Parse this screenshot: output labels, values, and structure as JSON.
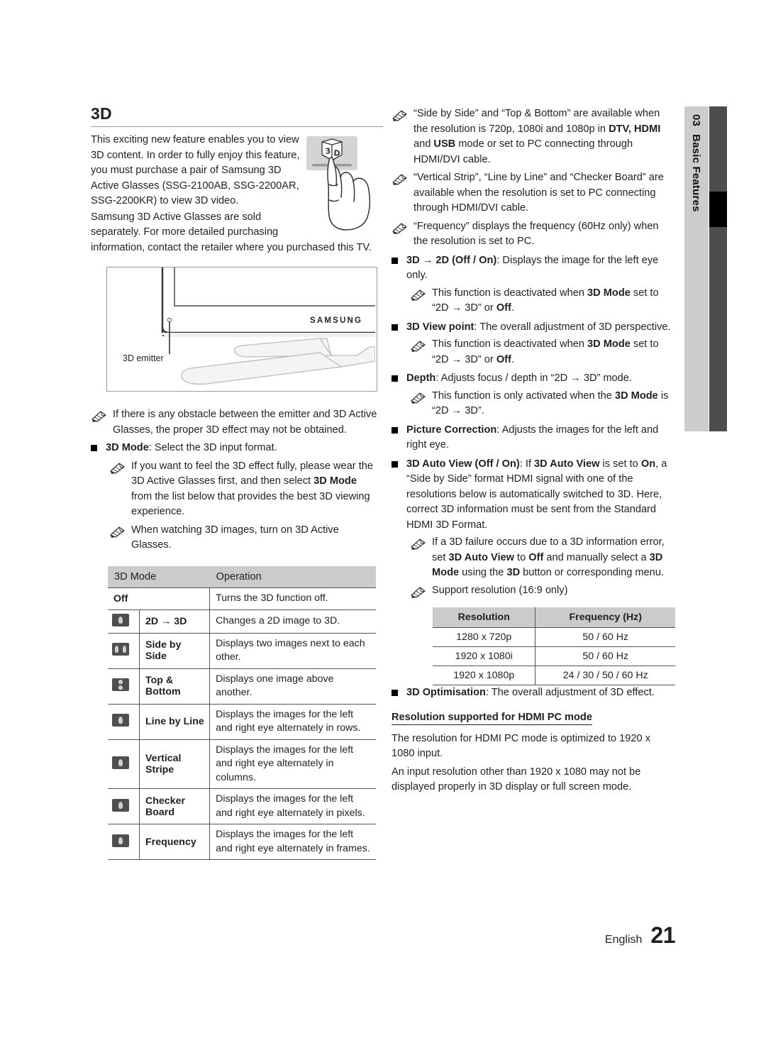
{
  "sidebar": {
    "chapter_number": "03",
    "chapter_title": "Basic Features"
  },
  "footer": {
    "language": "English",
    "page_number": "21"
  },
  "left": {
    "heading": "3D",
    "intro_p1": "This exciting new feature enables you to view 3D content. In order to fully enjoy this feature, you must purchase a pair of Samsung 3D Active Glasses (SSG-2100AB, SSG-2200AR, SSG-2200KR) to view 3D video.",
    "intro_p2": "Samsung 3D Active Glasses are sold separately. For more detailed purchasing",
    "intro_p3": "information, contact the retailer where you purchased this TV.",
    "figure": {
      "brand": "SAMSUNG",
      "callout": "3D emitter",
      "button_label": "3D"
    },
    "note_obstacle": "If there is any obstacle between the emitter and 3D Active Glasses, the proper 3D effect may not be obtained.",
    "bullet_3dmode_strong": "3D Mode",
    "bullet_3dmode_rest": ": Select the 3D input format.",
    "note_wear_a": "If you want to feel the 3D effect fully, please wear the 3D Active Glasses first, and then select ",
    "note_wear_b": "3D Mode",
    "note_wear_c": " from the list below that provides the best 3D viewing experience.",
    "note_turnon": "When watching 3D images, turn on 3D Active Glasses."
  },
  "mode_table": {
    "headers": [
      "3D Mode",
      "Operation"
    ],
    "rows": [
      {
        "icon": "none",
        "name": "Off",
        "operation": "Turns the 3D function off."
      },
      {
        "icon": "2d-to-3d-icon",
        "name": "2D → 3D",
        "operation": "Changes a 2D image to 3D."
      },
      {
        "icon": "side-by-side-icon",
        "name": "Side by Side",
        "operation": "Displays two images next to each other."
      },
      {
        "icon": "top-bottom-icon",
        "name": "Top & Bottom",
        "operation": "Displays one image above another."
      },
      {
        "icon": "line-by-line-icon",
        "name": "Line by Line",
        "operation": "Displays the images for the left and right eye alternately in rows."
      },
      {
        "icon": "vertical-stripe-icon",
        "name": "Vertical Stripe",
        "operation": "Displays the images for the left and right eye alternately in columns."
      },
      {
        "icon": "checker-board-icon",
        "name": "Checker Board",
        "operation": "Displays the images for the left and right eye alternately in pixels."
      },
      {
        "icon": "frequency-icon",
        "name": "Frequency",
        "operation": "Displays the images for the left and right eye alternately in frames."
      }
    ]
  },
  "right": {
    "note_sbs_a": "“Side by Side” and “Top & Bottom” are available when the resolution is 720p, 1080i and 1080p in ",
    "note_sbs_b": "DTV, HDMI",
    "note_sbs_c": " and ",
    "note_sbs_d": "USB",
    "note_sbs_e": " mode or set to PC connecting through HDMI/DVI cable.",
    "note_vstrip": "“Vertical Strip”, “Line by Line” and “Checker Board” are available when the resolution is set to PC connecting through HDMI/DVI cable.",
    "note_freq": "“Frequency” displays the frequency (60Hz only) when the resolution is set to PC.",
    "b1_strong": "3D → 2D (Off / On)",
    "b1_rest": ": Displays the image for the left eye only.",
    "b1_note_a": "This function is deactivated when ",
    "b1_note_b": "3D Mode",
    "b1_note_c": " set to “2D → 3D” or ",
    "b1_note_d": "Off",
    "b1_note_e": ".",
    "b2_strong": "3D View point",
    "b2_rest": ": The overall adjustment of 3D perspective.",
    "b2_note_a": "This function is deactivated when ",
    "b2_note_b": "3D Mode",
    "b2_note_c": " set to “2D → 3D” or ",
    "b2_note_d": "Off",
    "b2_note_e": ".",
    "b3_strong": "Depth",
    "b3_rest": ": Adjusts focus / depth in “2D → 3D” mode.",
    "b3_note_a": "This function is only activated when the ",
    "b3_note_b": "3D Mode",
    "b3_note_c": " is “2D → 3D”.",
    "b4_strong": "Picture Correction",
    "b4_rest": ": Adjusts the images for the left and right eye.",
    "b5_strong": "3D Auto View (Off / On)",
    "b5_mid1": ": If ",
    "b5_strong2": "3D Auto View",
    "b5_mid2": " is set to ",
    "b5_strong3": "On",
    "b5_rest": ", a “Side by Side” format HDMI signal with one of the resolutions below is automatically switched to 3D. Here, correct 3D information must be sent from the Standard HDMI 3D Format.",
    "b5_note_a": "If a 3D failure occurs due to a 3D information error, set ",
    "b5_note_b": "3D Auto View",
    "b5_note_c": " to ",
    "b5_note_d": "Off",
    "b5_note_e": " and manually select a ",
    "b5_note_f": "3D Mode",
    "b5_note_g": " using the ",
    "b5_note_h": "3D",
    "b5_note_i": " button or corresponding menu.",
    "note_support_res": "Support resolution (16:9 only)",
    "b6_strong": "3D Optimisation",
    "b6_rest": ": The overall adjustment of 3D effect.",
    "subhead": "Resolution supported for HDMI PC mode",
    "pc_p1": "The resolution for HDMI PC mode is optimized to 1920 x 1080 input.",
    "pc_p2": "An input resolution other than 1920 x 1080 may not be displayed properly in 3D display or full screen mode."
  },
  "resolution_table": {
    "headers": [
      "Resolution",
      "Frequency (Hz)"
    ],
    "rows": [
      [
        "1280 x 720p",
        "50 / 60 Hz"
      ],
      [
        "1920 x 1080i",
        "50 / 60 Hz"
      ],
      [
        "1920 x 1080p",
        "24 / 30 / 50 / 60 Hz"
      ]
    ]
  },
  "colors": {
    "tab_light": "#cccccc",
    "tab_dark": "#4d4d4d",
    "tab_active": "#000000",
    "table_header": "#cbcbcb"
  }
}
